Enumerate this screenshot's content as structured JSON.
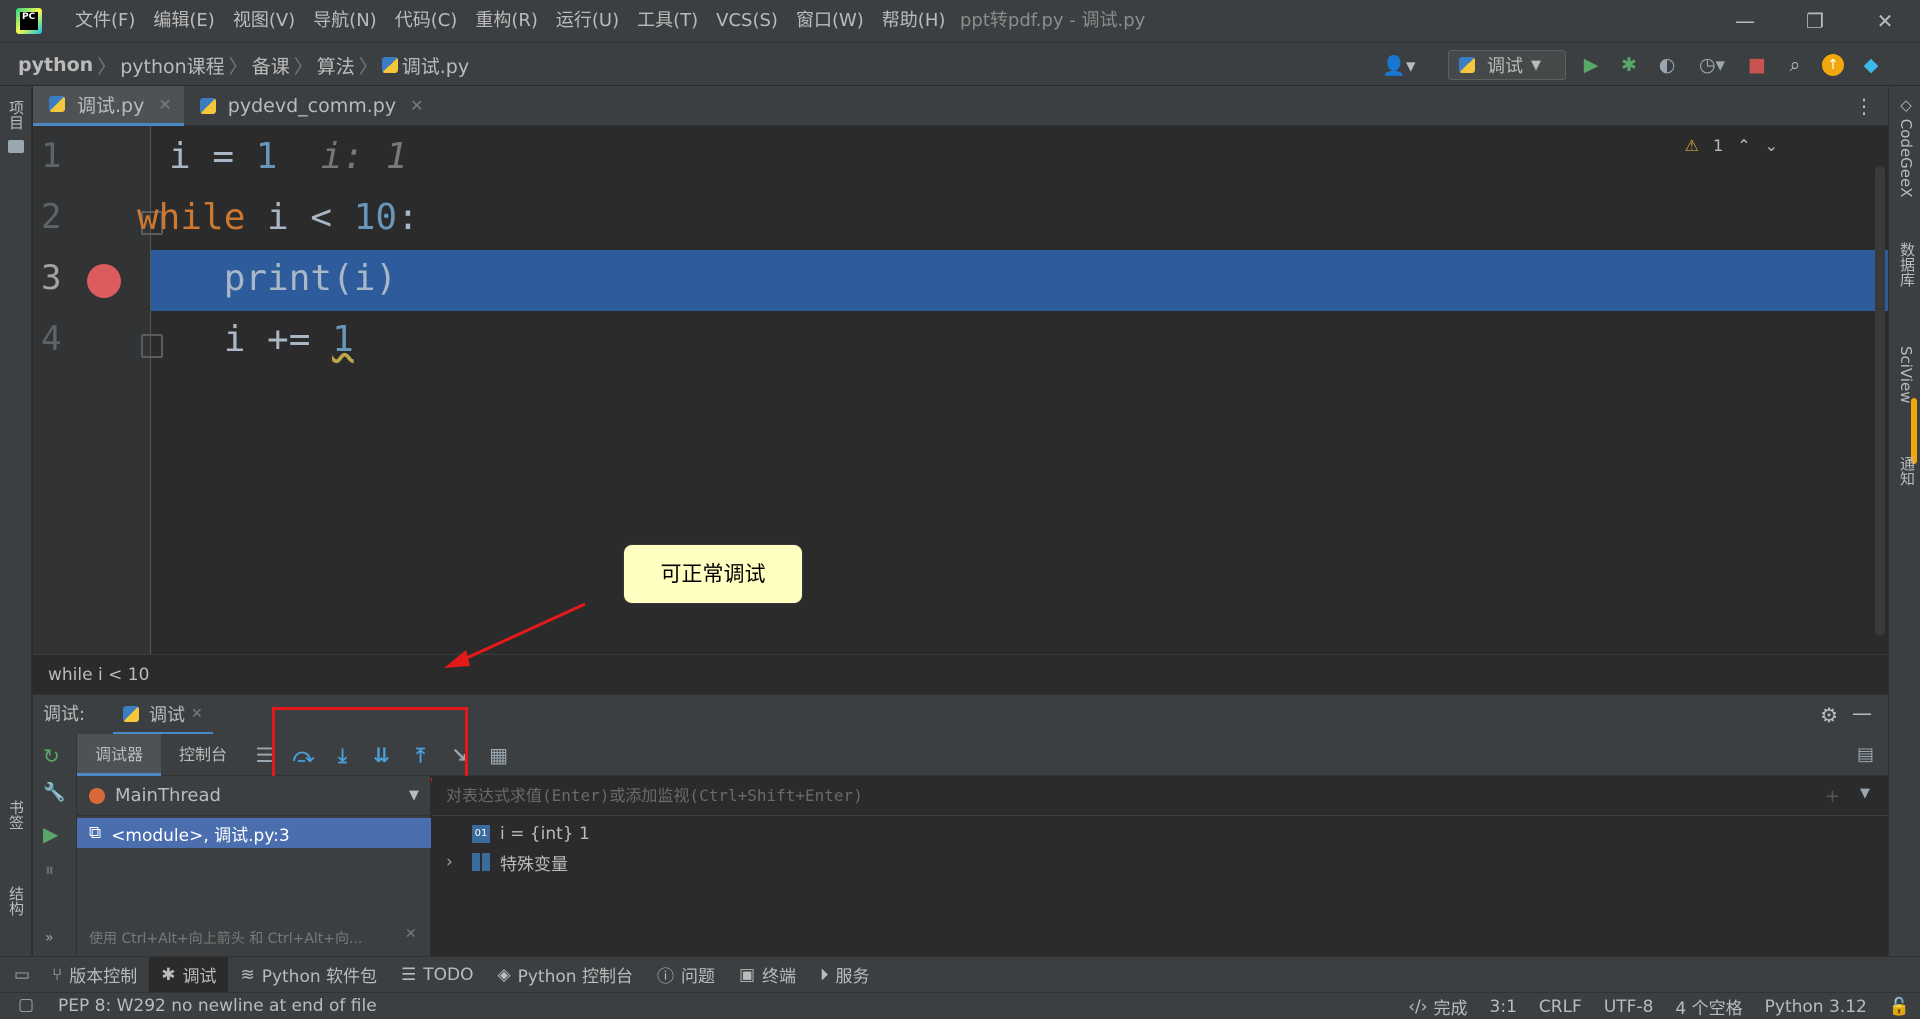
{
  "menu": [
    "文件(F)",
    "编辑(E)",
    "视图(V)",
    "导航(N)",
    "代码(C)",
    "重构(R)",
    "运行(U)",
    "工具(T)",
    "VCS(S)",
    "窗口(W)",
    "帮助(H)"
  ],
  "window_title": "ppt转pdf.py - 调试.py",
  "breadcrumb": [
    "python",
    "python课程",
    "备课",
    "算法",
    "调试.py"
  ],
  "run_config": "调试",
  "left_stripe": {
    "project": "项目",
    "bookmarks": "书签",
    "structure": "结构"
  },
  "right_stripe": [
    "CodeGeeX",
    "数据库",
    "SciView",
    "通知"
  ],
  "editor_tabs": [
    {
      "label": "调试.py",
      "active": true
    },
    {
      "label": "pydevd_comm.py",
      "active": false
    }
  ],
  "code": {
    "line_numbers": [
      "1",
      "2",
      "3",
      "4"
    ],
    "l1_var": "i",
    "l1_op": " = ",
    "l1_num": "1",
    "l1_inlay": "i: 1",
    "l2_kw": "while",
    "l2_rest": " i < ",
    "l2_num": "10",
    "l2_colon": ":",
    "l3_text": "    print(i)",
    "l4_text": "    i += ",
    "l4_num": "1",
    "warnings": "1"
  },
  "editor_breadcrumb": "while i < 10",
  "callout": "可正常调试",
  "debug": {
    "label": "调试:",
    "session_tab": "调试",
    "subtabs": [
      "调试器",
      "控制台"
    ],
    "thread": "MainThread",
    "frame": "<module>, 调试.py:3",
    "frames_hint": "使用 Ctrl+Alt+向上箭头 和 Ctrl+Alt+向...",
    "eval_placeholder": "对表达式求值(Enter)或添加监视(Ctrl+Shift+Enter)",
    "variables": [
      {
        "icon": "01",
        "text": "i = {int} 1"
      },
      {
        "icon": "grid",
        "text": "特殊变量"
      }
    ]
  },
  "bottom_tabs": [
    "版本控制",
    "调试",
    "Python 软件包",
    "TODO",
    "Python 控制台",
    "问题",
    "终端",
    "服务"
  ],
  "status": {
    "message": "PEP 8: W292 no newline at end of file",
    "right": [
      "完成",
      "3:1",
      "CRLF",
      "UTF-8",
      "4 个空格",
      "Python 3.12"
    ]
  },
  "colors": {
    "accent": "#4a88c7",
    "highlight_line": "#2d5b9b",
    "breakpoint": "#db5c5c",
    "annotation_box": "#e41a1a",
    "callout_bg": "#ffffc2"
  }
}
